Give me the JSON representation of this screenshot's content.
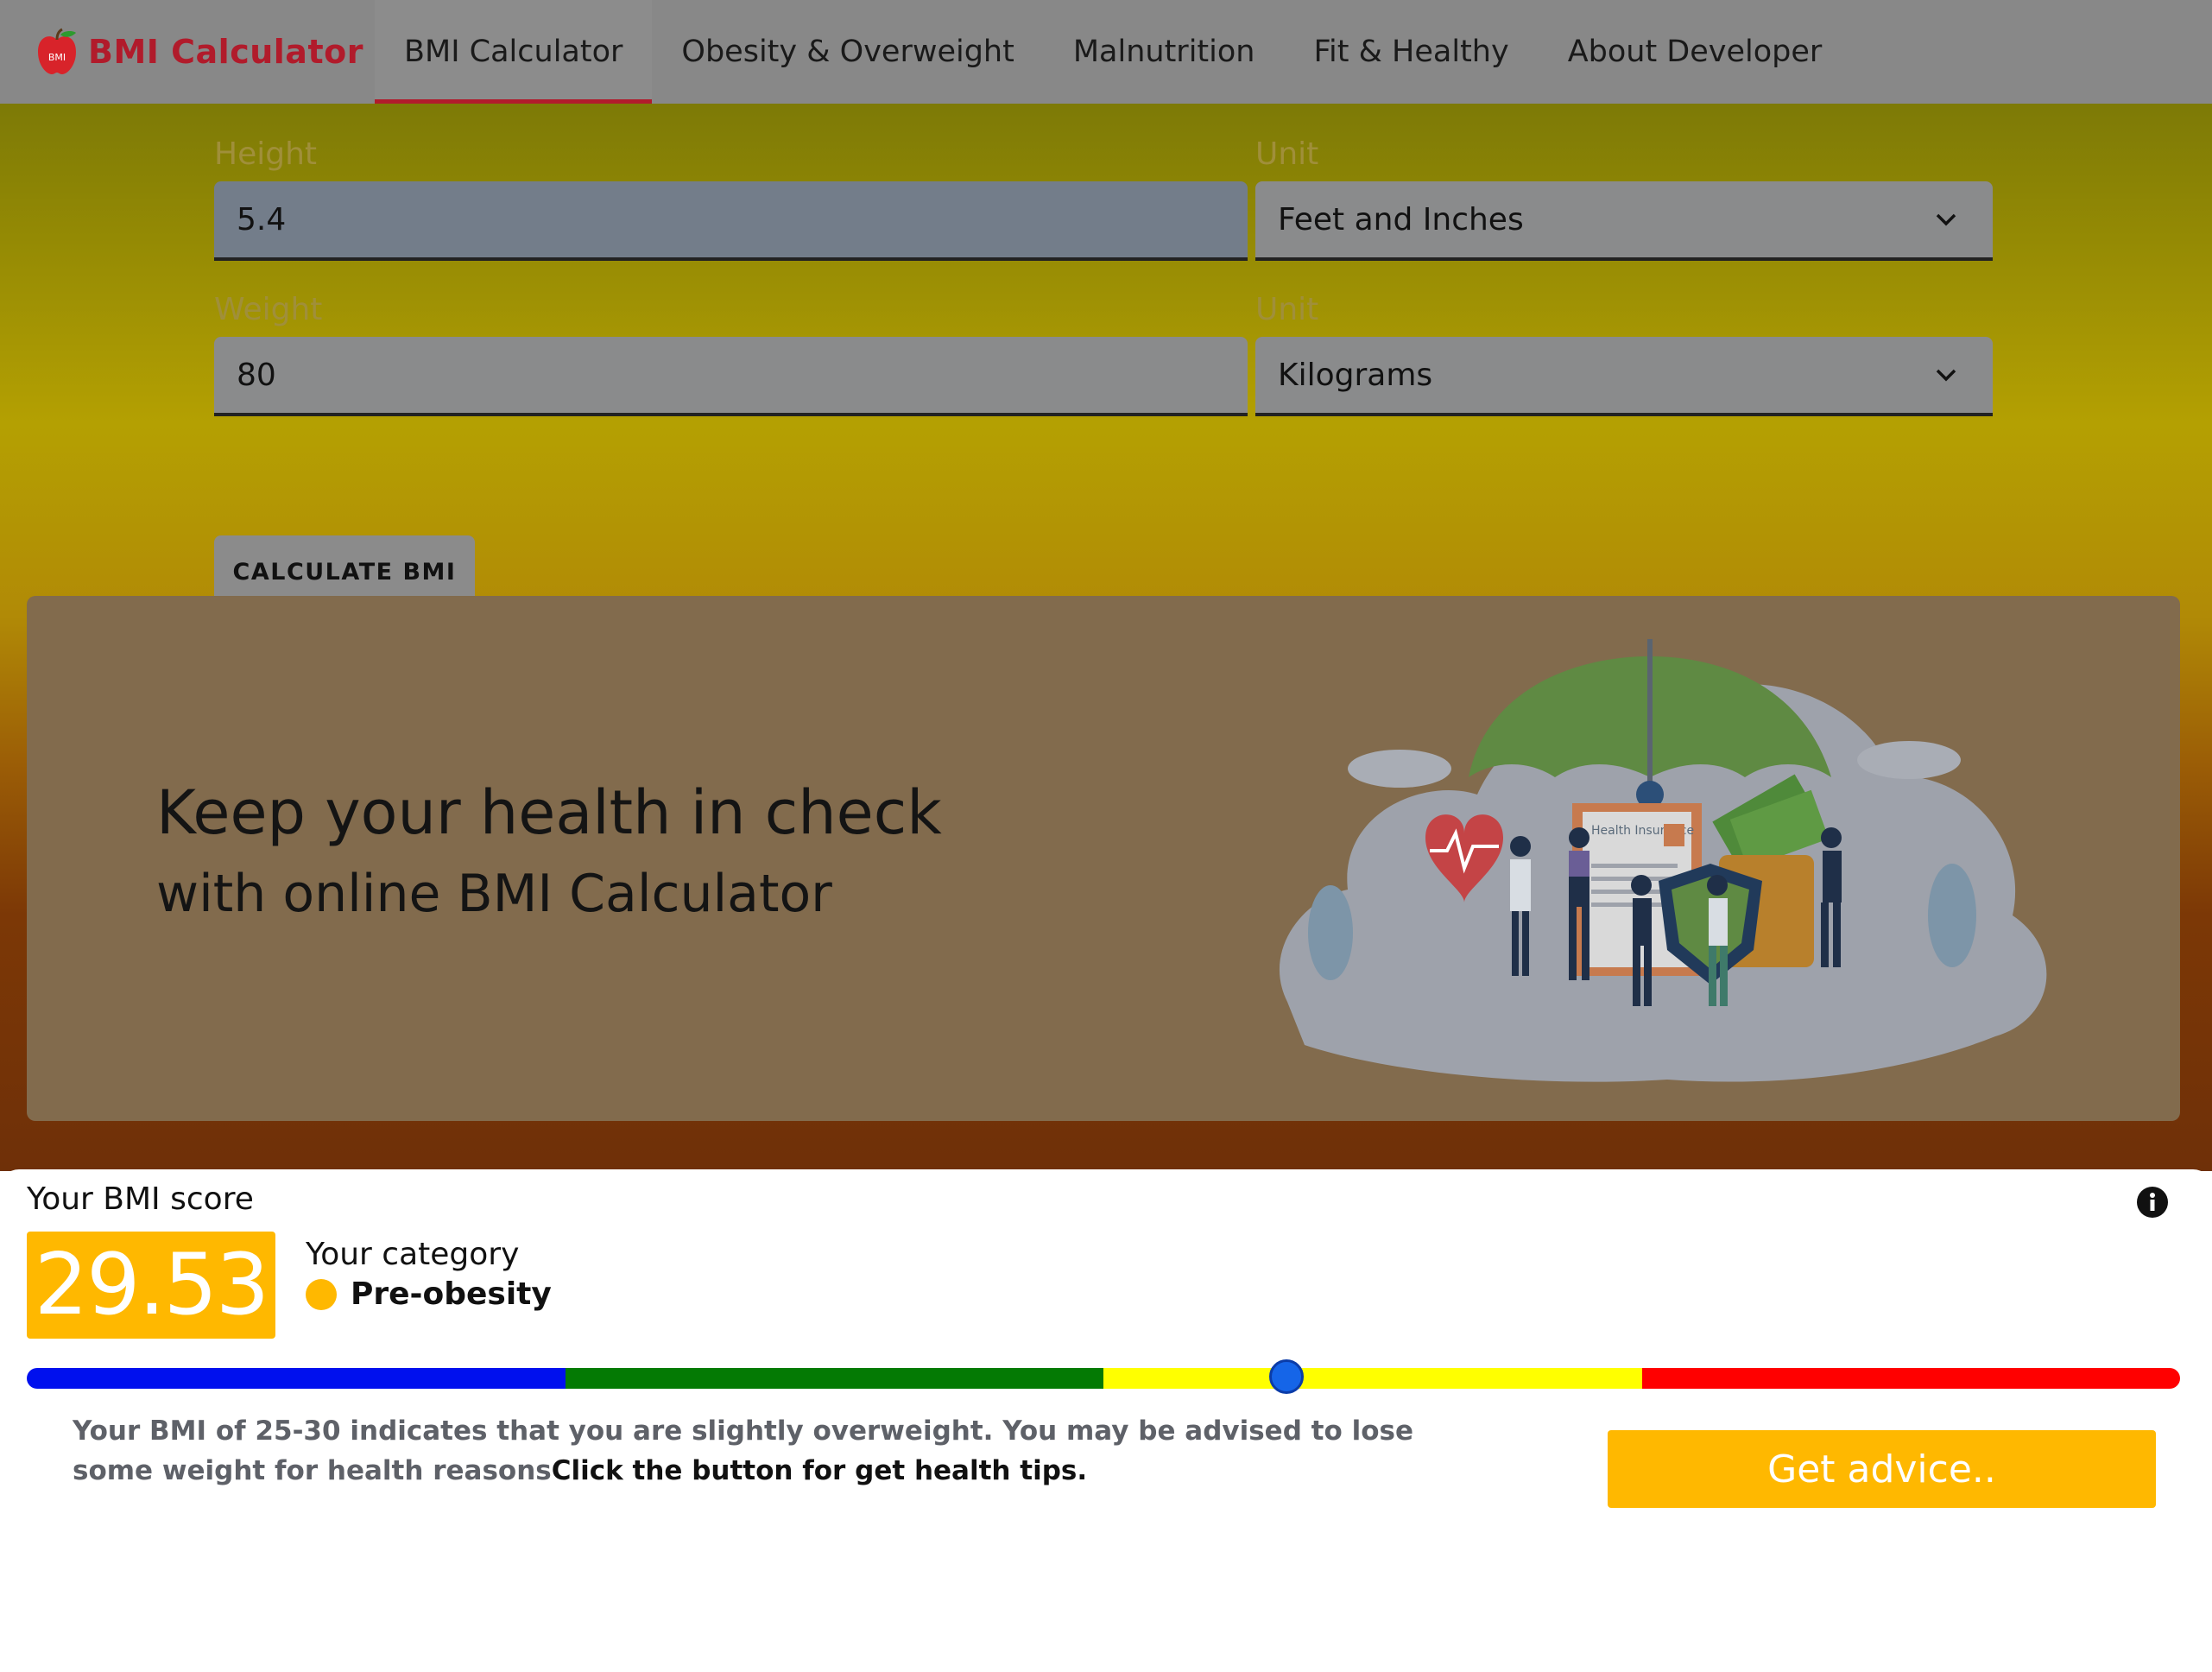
{
  "nav": {
    "brand": "BMI Calculator",
    "logo_text": "BMI",
    "tabs": [
      {
        "label": "BMI Calculator",
        "active": true
      },
      {
        "label": "Obesity & Overweight",
        "active": false
      },
      {
        "label": "Malnutrition",
        "active": false
      },
      {
        "label": "Fit & Healthy",
        "active": false
      },
      {
        "label": "About Developer",
        "active": false
      }
    ]
  },
  "form": {
    "height_label": "Height",
    "height_value": "5.4",
    "height_unit_label": "Unit",
    "height_unit_value": "Feet and Inches",
    "weight_label": "Weight",
    "weight_value": "80",
    "weight_unit_label": "Unit",
    "weight_unit_value": "Kilograms",
    "calculate_label": "CALCULATE BMI"
  },
  "promo": {
    "headline": "Keep your health in check",
    "subline": "with online BMI Calculator",
    "illustration_text": "Health Insurance"
  },
  "result": {
    "title": "Your BMI score",
    "score": "29.53",
    "category_title": "Your category",
    "category": "Pre-obesity",
    "scale_colors": [
      "#0010ee",
      "#047a04",
      "#ffff00",
      "#ff0000"
    ],
    "marker_position": 0.585,
    "advice_text": "Your BMI of 25-30 indicates that you are slightly overweight. You may be advised to lose some weight for health reasons",
    "advice_cta": "Click the button for get health tips.",
    "advice_button": "Get advice.."
  },
  "colors": {
    "brand": "#b11b2b",
    "accent": "#ffb800",
    "marker": "#1565e8"
  }
}
